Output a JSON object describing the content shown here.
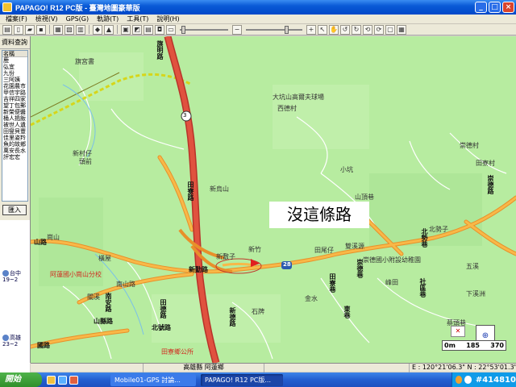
{
  "window": {
    "title": "PAPAGO! R12 PC版 - 臺灣地圖豪華版",
    "controls": [
      "_",
      "□",
      "×"
    ]
  },
  "menu": {
    "items": [
      "檔案(F)",
      "檢視(V)",
      "GPS(G)",
      "軌跡(T)",
      "工具(T)",
      "說明(H)"
    ]
  },
  "sidebar": {
    "header": "資料查詢",
    "list": [
      "名稱",
      "鹿",
      "弘宜",
      "九份",
      "三阿姨",
      "花園農市",
      "甲信宇路",
      "吉祥四家",
      "望丁包郵",
      "新榮便醬",
      "桶人搗飯",
      "被世人遺",
      "田燮貝豐",
      "佳里姿羚",
      "魚的故鄉",
      "萬安長水",
      "評宏宏"
    ],
    "button": "匯入",
    "weather": [
      {
        "city": "台中",
        "temp": "19~2"
      },
      {
        "city": "高雄",
        "temp": "23~2"
      }
    ],
    "footer": "當圖"
  },
  "map": {
    "callout": "沒這條路",
    "labels": {
      "north_town": "旗宮書",
      "dakeng": "大坑山高爾夫球場",
      "xiyingcun": "西德村",
      "xinwushan": "新烏山",
      "shanding": "山頂巷",
      "beishe": "北勢子",
      "tianliao": "田尾坑",
      "xinzhu": "新竹",
      "xinzi": "新敷子",
      "tianweixi": "田尾仔",
      "shuangxi": "雙溪源",
      "chongde": "崇德國小附設幼稚園",
      "ali": "阿蓮國小崗山分校",
      "nanding": "南山路",
      "shichuan": "石牌",
      "xiaxi": "下溪洲",
      "mudou": "蔡頭巷",
      "tianliao_hall": "田寮鄉公所",
      "gangshan": "崗山",
      "xinchun": "新村仔",
      "chongde2": "崇德村",
      "tianliao3": "田寮村",
      "zhenqian": "頭前",
      "wuxi": "五溪",
      "hengwu": "橫屋",
      "xiaoxi": "小坑",
      "fengtian": "峰田",
      "jinshui": "金水",
      "guanxi": "關溪"
    },
    "road_labels": {
      "r1": "崇德路",
      "r2": "新勤路",
      "r3": "田寮路",
      "r4": "山路",
      "r5": "北勢巷",
      "r6": "崇德巷",
      "r7": "田寮巷",
      "r8": "南安路",
      "r9": "新德路",
      "r10": "國路",
      "r11": "山縣路",
      "r12": "旗明路",
      "r13": "北號路",
      "r14": "田德路",
      "r15": "社區巷",
      "r16": "東巷"
    },
    "route_numbers": {
      "highway": "3",
      "provincial": "28"
    },
    "scale": {
      "start": "0m",
      "mid": "185",
      "end": "370"
    },
    "gps_badge": "✕",
    "compass": "⊕"
  },
  "statusbar": {
    "location": "高雄縣 阿蓮鄉",
    "coords": "E : 120°21'06.3\"  N : 22°53'01.3\""
  },
  "taskbar": {
    "start": "開始",
    "tasks": [
      "Mobile01-GPS 討論...",
      "PAPAGO! R12 PC版..."
    ],
    "clock": "#414810"
  },
  "colors": {
    "map_bg": "#b7eca0",
    "highway": "#e0523f",
    "road": "#f4a535",
    "minor_road": "#ffffff",
    "rail": "#d0d000"
  }
}
